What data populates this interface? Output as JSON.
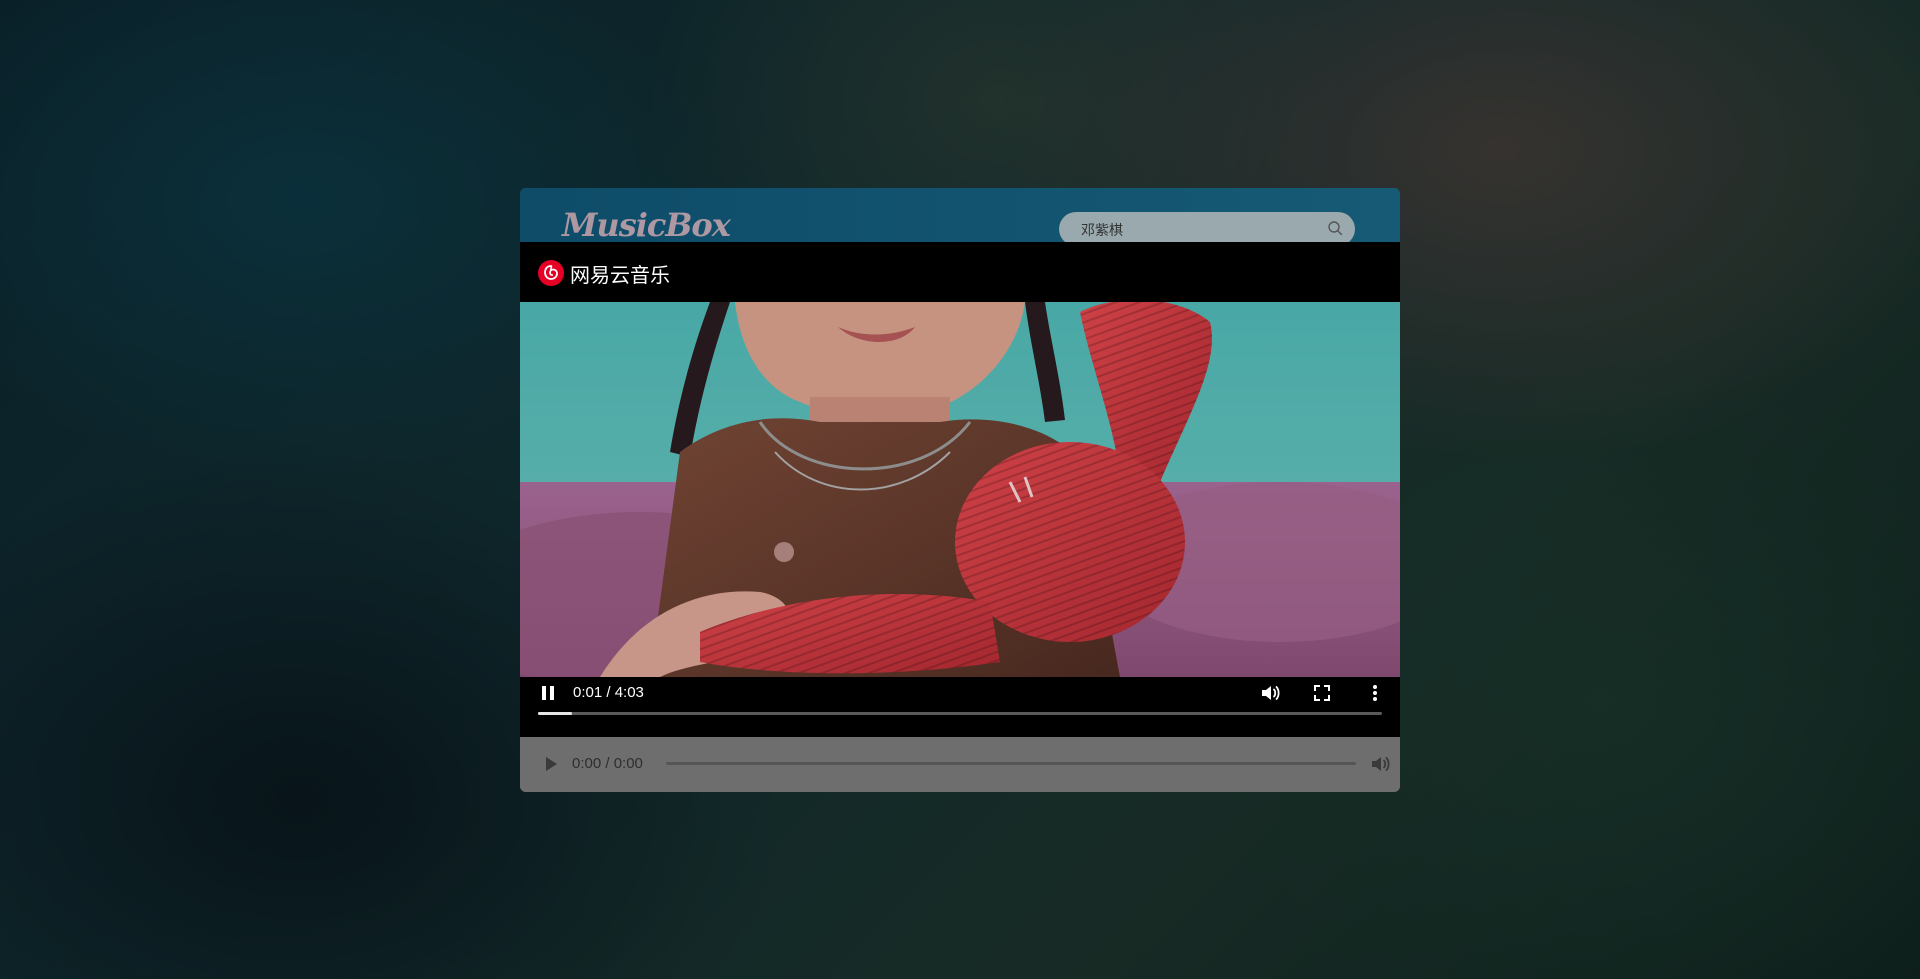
{
  "app": {
    "logo_text": "MusicBox"
  },
  "search": {
    "value": "邓紫棋",
    "icon": "search-icon"
  },
  "video_player": {
    "brand_name": "网易云音乐",
    "brand_icon": "netease-cloud-music-logo",
    "time_display": "0:01 / 4:03",
    "progress": 0.04,
    "controls": {
      "play_pause_icon": "pause-icon",
      "volume_icon": "volume-icon",
      "fullscreen_icon": "fullscreen-icon",
      "more_icon": "more-vertical-icon"
    }
  },
  "audio_player": {
    "time_display": "0:00 / 0:00",
    "progress": 0,
    "controls": {
      "play_icon": "play-icon",
      "volume_icon": "volume-icon"
    }
  },
  "colors": {
    "brand_red": "#e60026",
    "header_bg": "#0e4c68",
    "overlay": "rgba(0,0,0,0.45)"
  }
}
